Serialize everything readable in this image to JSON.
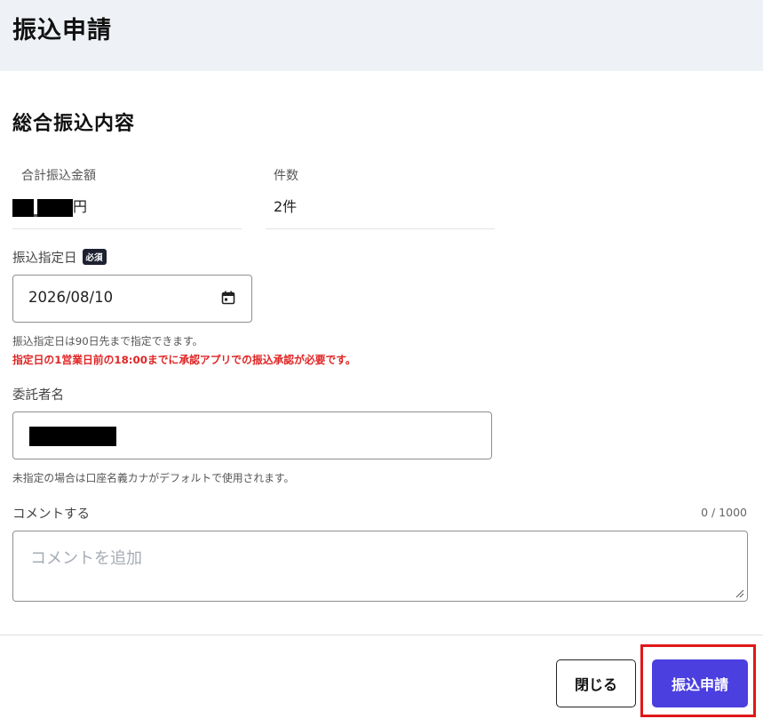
{
  "header": {
    "title": "振込申請"
  },
  "section": {
    "title": "総合振込内容"
  },
  "summary": {
    "total_label": "合計振込金額",
    "total_unit": "円",
    "count_label": "件数",
    "count_value": "2件"
  },
  "transfer_date": {
    "label": "振込指定日",
    "required_badge": "必須",
    "value": "2026/08/10",
    "hint": "振込指定日は90日先まで指定できます。",
    "warning": "指定日の1営業日前の18:00までに承認アプリでの振込承認が必要です。"
  },
  "consignor": {
    "label": "委託者名",
    "hint": "未指定の場合は口座名義カナがデフォルトで使用されます。"
  },
  "comment": {
    "label": "コメントする",
    "counter": "0 / 1000",
    "placeholder": "コメントを追加"
  },
  "footer": {
    "close_label": "閉じる",
    "submit_label": "振込申請"
  },
  "colors": {
    "header_bg": "#eef2f6",
    "primary": "#4b3fe0",
    "warning": "#e02424",
    "highlight": "#e01818"
  }
}
